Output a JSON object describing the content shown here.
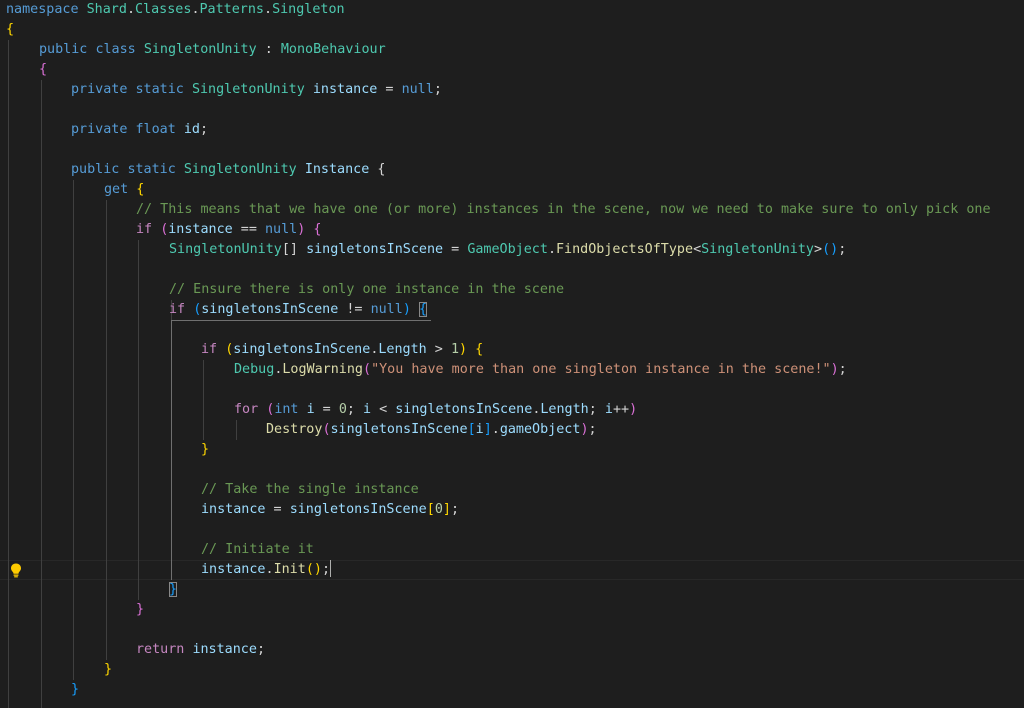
{
  "editor": {
    "colors": {
      "background": "#1e1e1e",
      "keyword": "#569cd6",
      "control_keyword": "#c586c0",
      "type": "#4ec9b0",
      "function": "#dcdcaa",
      "variable": "#9cdcfe",
      "string": "#ce9178",
      "number": "#b5cea8",
      "comment": "#6a9955",
      "bracket_level_1": "#ffd700",
      "bracket_level_2": "#da70d6",
      "bracket_level_3": "#179fff"
    },
    "gutter_icon": "lightbulb-icon",
    "code": {
      "l1": {
        "t1": "namespace",
        "t2": "Shard",
        "t3": ".",
        "t4": "Classes",
        "t5": ".",
        "t6": "Patterns",
        "t7": ".",
        "t8": "Singleton"
      },
      "l2": {
        "t1": "{"
      },
      "l3": {
        "t1": "public",
        "t2": "class",
        "t3": "SingletonUnity",
        "t4": " : ",
        "t5": "MonoBehaviour"
      },
      "l4": {
        "t1": "{"
      },
      "l5": {
        "t1": "private",
        "t2": "static",
        "t3": "SingletonUnity",
        "t4": "instance",
        "t5": " = ",
        "t6": "null",
        "t7": ";"
      },
      "l7": {
        "t1": "private",
        "t2": "float",
        "t3": "id",
        "t4": ";"
      },
      "l9": {
        "t1": "public",
        "t2": "static",
        "t3": "SingletonUnity",
        "t4": "Instance",
        "t5": " {"
      },
      "l10": {
        "t1": "get",
        "t2": "{"
      },
      "l11": {
        "t1": "// This means that we have one (or more) instances in the scene, now we need to make sure to only pick one"
      },
      "l12": {
        "t1": "if",
        "t2": "(",
        "t3": "instance",
        "t4": " == ",
        "t5": "null",
        "t6": ")",
        "t7": "{"
      },
      "l13": {
        "t1": "SingletonUnity",
        "t2": "[] ",
        "t3": "singletonsInScene",
        "t4": " = ",
        "t5": "GameObject",
        "t6": ".",
        "t7": "FindObjectsOfType",
        "t8": "<",
        "t9": "SingletonUnity",
        "t10": ">",
        "t11": "()",
        "t12": ";"
      },
      "l15": {
        "t1": "// Ensure there is only one instance in the scene"
      },
      "l16": {
        "t1": "if",
        "t2": "(",
        "t3": "singletonsInScene",
        "t4": " != ",
        "t5": "null",
        "t6": ")",
        "t7": "{"
      },
      "l18": {
        "t1": "if",
        "t2": "(",
        "t3": "singletonsInScene",
        "t4": ".",
        "t5": "Length",
        "t6": " > ",
        "t7": "1",
        "t8": ")",
        "t9": "{"
      },
      "l19": {
        "t1": "Debug",
        "t2": ".",
        "t3": "LogWarning",
        "t4": "(",
        "t5": "\"You have more than one singleton instance in the scene!\"",
        "t6": ")",
        "t7": ";"
      },
      "l21": {
        "t1": "for",
        "t2": "(",
        "t3": "int",
        "t4": "i",
        "t5": " = ",
        "t6": "0",
        "t7": "; ",
        "t8": "i",
        "t9": " < ",
        "t10": "singletonsInScene",
        "t11": ".",
        "t12": "Length",
        "t13": "; ",
        "t14": "i",
        "t15": "++",
        "t16": ")"
      },
      "l22": {
        "t1": "Destroy",
        "t2": "(",
        "t3": "singletonsInScene",
        "t4": "[",
        "t5": "i",
        "t6": "]",
        "t7": ".",
        "t8": "gameObject",
        "t9": ")",
        "t10": ";"
      },
      "l23": {
        "t1": "}"
      },
      "l25": {
        "t1": "// Take the single instance"
      },
      "l26": {
        "t1": "instance",
        "t2": " = ",
        "t3": "singletonsInScene",
        "t4": "[",
        "t5": "0",
        "t6": "]",
        "t7": ";"
      },
      "l28": {
        "t1": "// Initiate it"
      },
      "l29": {
        "t1": "instance",
        "t2": ".",
        "t3": "Init",
        "t4": "()",
        "t5": ";"
      },
      "l30": {
        "t1": "}"
      },
      "l31": {
        "t1": "}"
      },
      "l33": {
        "t1": "return",
        "t2": "instance",
        "t3": ";"
      },
      "l34": {
        "t1": "}"
      },
      "l35": {
        "t1": "}"
      }
    }
  }
}
